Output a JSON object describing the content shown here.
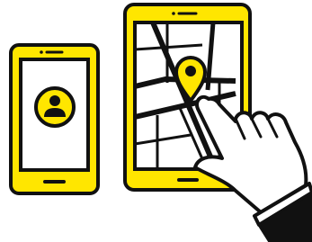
{
  "illustration": {
    "icons": [
      "smartphone-icon",
      "user-avatar-icon",
      "tablet-icon",
      "map-icon",
      "location-pin-icon",
      "pointing-hand-icon"
    ]
  },
  "colors": {
    "device_yellow": "#FFE600",
    "outline_black": "#111111",
    "screen_white": "#FFFFFF",
    "background": "#FFFFFF"
  }
}
